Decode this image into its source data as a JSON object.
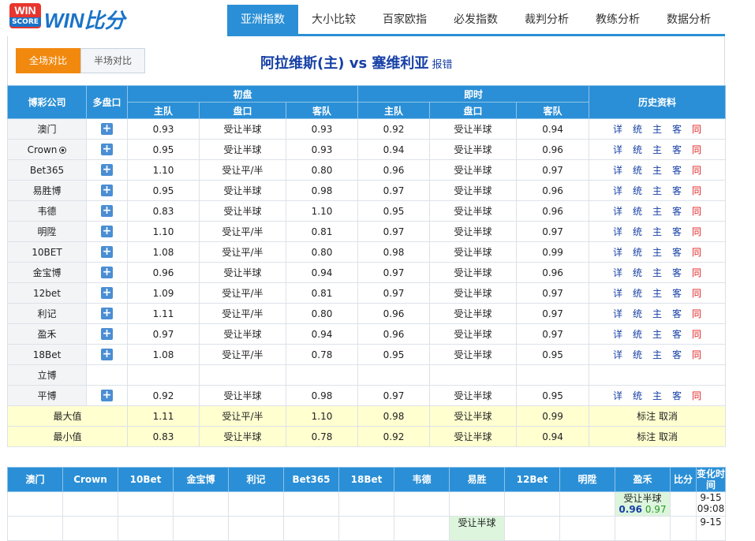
{
  "logo": {
    "badge_top": "WIN",
    "badge_bottom": "SCORE",
    "text": "WIN比分"
  },
  "nav": {
    "tabs": [
      "亚洲指数",
      "大小比较",
      "百家欧指",
      "必发指数",
      "裁判分析",
      "教练分析",
      "数据分析"
    ],
    "active": 0
  },
  "subtabs": {
    "items": [
      "全场对比",
      "半场对比"
    ],
    "active": 0
  },
  "match": {
    "title": "阿拉维斯(主) vs 塞维利亚",
    "report": "报错"
  },
  "odds_table": {
    "headers": {
      "company": "博彩公司",
      "multi": "多盘口",
      "initial": "初盘",
      "live": "即时",
      "history": "历史资料",
      "home": "主队",
      "handicap": "盘口",
      "away": "客队"
    },
    "rows": [
      {
        "company": "澳门",
        "i_home": "0.93",
        "i_hcp": "受让半球",
        "i_away": "0.93",
        "l_home": "0.92",
        "l_hcp": "受让半球",
        "l_away": "0.94",
        "has_plus": true
      },
      {
        "company": "Crown",
        "ball": true,
        "i_home": "0.95",
        "i_hcp": "受让半球",
        "i_away": "0.93",
        "l_home": "0.94",
        "l_hcp": "受让半球",
        "l_away": "0.96",
        "has_plus": true
      },
      {
        "company": "Bet365",
        "i_home": "1.10",
        "i_hcp": "受让平/半",
        "i_away": "0.80",
        "l_home": "0.96",
        "l_hcp": "受让半球",
        "l_away": "0.97",
        "has_plus": true
      },
      {
        "company": "易胜博",
        "i_home": "0.95",
        "i_hcp": "受让半球",
        "i_away": "0.98",
        "l_home": "0.97",
        "l_hcp": "受让半球",
        "l_away": "0.96",
        "has_plus": true
      },
      {
        "company": "韦德",
        "i_home": "0.83",
        "i_hcp": "受让半球",
        "i_away": "1.10",
        "l_home": "0.95",
        "l_hcp": "受让半球",
        "l_away": "0.96",
        "has_plus": true
      },
      {
        "company": "明陞",
        "i_home": "1.10",
        "i_hcp": "受让平/半",
        "i_away": "0.81",
        "l_home": "0.97",
        "l_hcp": "受让半球",
        "l_away": "0.97",
        "has_plus": true
      },
      {
        "company": "10BET",
        "i_home": "1.08",
        "i_hcp": "受让平/半",
        "i_away": "0.80",
        "l_home": "0.98",
        "l_hcp": "受让半球",
        "l_away": "0.99",
        "has_plus": true
      },
      {
        "company": "金宝博",
        "i_home": "0.96",
        "i_hcp": "受让半球",
        "i_away": "0.94",
        "l_home": "0.97",
        "l_hcp": "受让半球",
        "l_away": "0.96",
        "has_plus": true
      },
      {
        "company": "12bet",
        "i_home": "1.09",
        "i_hcp": "受让平/半",
        "i_away": "0.81",
        "l_home": "0.97",
        "l_hcp": "受让半球",
        "l_away": "0.97",
        "has_plus": true
      },
      {
        "company": "利记",
        "i_home": "1.11",
        "i_hcp": "受让平/半",
        "i_away": "0.80",
        "l_home": "0.96",
        "l_hcp": "受让半球",
        "l_away": "0.97",
        "has_plus": true
      },
      {
        "company": "盈禾",
        "i_home": "0.97",
        "i_hcp": "受让半球",
        "i_away": "0.94",
        "l_home": "0.96",
        "l_hcp": "受让半球",
        "l_away": "0.97",
        "has_plus": true
      },
      {
        "company": "18Bet",
        "i_home": "1.08",
        "i_hcp": "受让平/半",
        "i_away": "0.78",
        "l_home": "0.95",
        "l_hcp": "受让半球",
        "l_away": "0.95",
        "has_plus": true
      },
      {
        "company": "立博",
        "i_home": "",
        "i_hcp": "",
        "i_away": "",
        "l_home": "",
        "l_hcp": "",
        "l_away": "",
        "has_plus": false
      },
      {
        "company": "平博",
        "i_home": "0.92",
        "i_hcp": "受让半球",
        "i_away": "0.98",
        "l_home": "0.97",
        "l_hcp": "受让半球",
        "l_away": "0.95",
        "has_plus": true
      }
    ],
    "history_links": [
      {
        "label": "详",
        "red": false
      },
      {
        "label": "统",
        "red": false
      },
      {
        "label": "主",
        "red": false
      },
      {
        "label": "客",
        "red": false
      },
      {
        "label": "同",
        "red": true
      }
    ],
    "stats": [
      {
        "label": "最大值",
        "i_home": "1.11",
        "i_hcp": "受让平/半",
        "i_away": "1.10",
        "l_home": "0.98",
        "l_hcp": "受让半球",
        "l_away": "0.99",
        "actions": "标注 取消"
      },
      {
        "label": "最小值",
        "i_home": "0.83",
        "i_hcp": "受让半球",
        "i_away": "0.78",
        "l_home": "0.92",
        "l_hcp": "受让半球",
        "l_away": "0.94",
        "actions": "标注 取消"
      }
    ]
  },
  "compare_table": {
    "headers": [
      "澳门",
      "Crown",
      "10Bet",
      "金宝博",
      "利记",
      "Bet365",
      "18Bet",
      "韦德",
      "易胜",
      "12Bet",
      "明陞",
      "盈禾",
      "比分",
      "变化时间"
    ],
    "rows": [
      {
        "cells": {
          "11": {
            "hcp": "受让半球",
            "home": "0.96",
            "away": "0.97"
          }
        },
        "time": "9-15 09:08"
      },
      {
        "cells": {
          "8": {
            "hcp": "受让半球",
            "home": "",
            "away": ""
          }
        },
        "time": "9-15"
      }
    ]
  }
}
